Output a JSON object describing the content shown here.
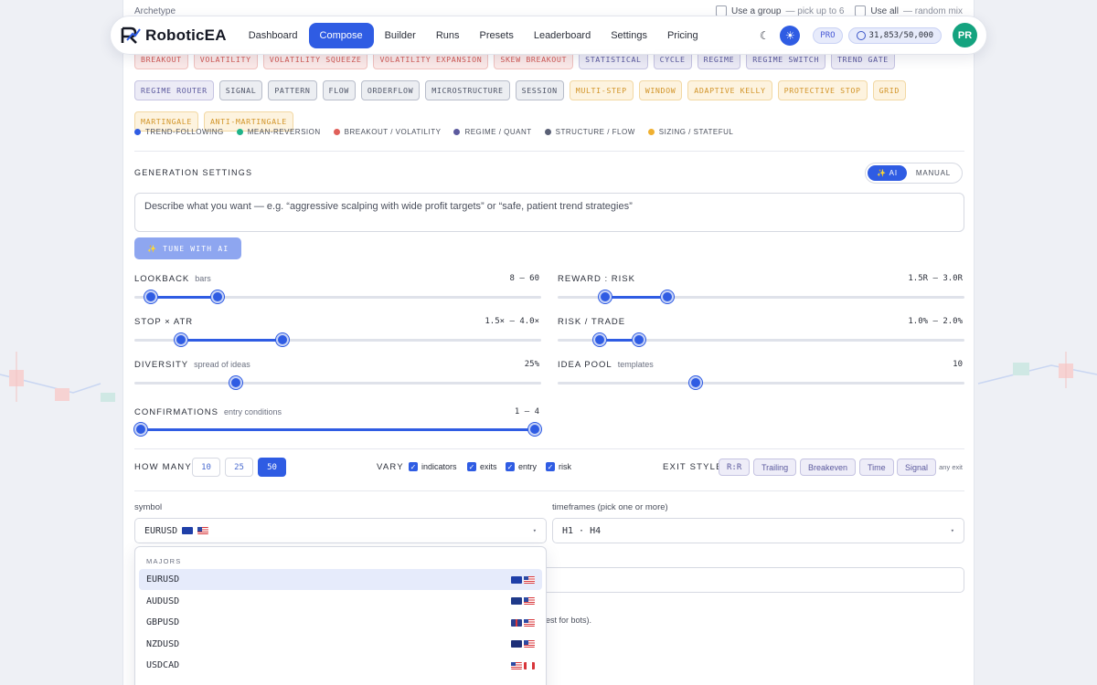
{
  "archetype_label": "Archetype",
  "group_options": {
    "use_group": "Use a group",
    "use_group_hint": "— pick up to 6",
    "use_all": "Use all",
    "use_all_hint": "— random mix"
  },
  "nav": {
    "brand": "RoboticEA",
    "links": [
      "Dashboard",
      "Compose",
      "Builder",
      "Runs",
      "Presets",
      "Leaderboard",
      "Settings",
      "Pricing"
    ],
    "active": "Compose",
    "plan_badge": "PRO",
    "credits": "31,853/50,000",
    "avatar_initials": "PR"
  },
  "chips": {
    "row1": [
      {
        "label": "BREAKOUT",
        "tone": "red"
      },
      {
        "label": "VOLATILITY",
        "tone": "red"
      },
      {
        "label": "VOLATILITY SQUEEZE",
        "tone": "red"
      },
      {
        "label": "VOLATILITY EXPANSION",
        "tone": "red"
      },
      {
        "label": "SKEW BREAKOUT",
        "tone": "red"
      },
      {
        "label": "STATISTICAL",
        "tone": "purple"
      },
      {
        "label": "CYCLE",
        "tone": "purple"
      },
      {
        "label": "REGIME",
        "tone": "purple"
      },
      {
        "label": "REGIME SWITCH",
        "tone": "purple"
      },
      {
        "label": "TREND GATE",
        "tone": "purple"
      }
    ],
    "row2": [
      {
        "label": "REGIME ROUTER",
        "tone": "purple"
      },
      {
        "label": "SIGNAL",
        "tone": "gray"
      },
      {
        "label": "PATTERN",
        "tone": "gray"
      },
      {
        "label": "FLOW",
        "tone": "gray"
      },
      {
        "label": "ORDERFLOW",
        "tone": "gray"
      },
      {
        "label": "MICROSTRUCTURE",
        "tone": "gray"
      },
      {
        "label": "SESSION",
        "tone": "gray"
      },
      {
        "label": "MULTI-STEP",
        "tone": "yellow"
      },
      {
        "label": "WINDOW",
        "tone": "yellow"
      },
      {
        "label": "ADAPTIVE KELLY",
        "tone": "yellow"
      },
      {
        "label": "PROTECTIVE STOP",
        "tone": "yellow"
      },
      {
        "label": "GRID",
        "tone": "yellow"
      }
    ],
    "row3": [
      {
        "label": "MARTINGALE",
        "tone": "yellow"
      },
      {
        "label": "ANTI-MARTINGALE",
        "tone": "yellow"
      }
    ]
  },
  "legend": [
    {
      "label": "TREND-FOLLOWING",
      "color": "#2f5ce3"
    },
    {
      "label": "MEAN-REVERSION",
      "color": "#1fb38a"
    },
    {
      "label": "BREAKOUT / VOLATILITY",
      "color": "#e0605a"
    },
    {
      "label": "REGIME / QUANT",
      "color": "#5c5a9e"
    },
    {
      "label": "STRUCTURE / FLOW",
      "color": "#5a6075"
    },
    {
      "label": "SIZING / STATEFUL",
      "color": "#f0b030"
    }
  ],
  "generation": {
    "title": "GENERATION SETTINGS",
    "mode_ai": "✨ AI",
    "mode_manual": "MANUAL",
    "prompt_placeholder": "Describe what you want — e.g. “aggressive scalping with wide profit targets” or “safe, patient trend strategies”",
    "tune_button": "TUNE WITH AI",
    "tune_icon": "sparkle-icon"
  },
  "sliders": {
    "lookback": {
      "label": "LOOKBACK",
      "sub": "bars",
      "value_text": "8 – 60",
      "low": 0.04,
      "high": 0.205
    },
    "reward_risk": {
      "label": "REWARD : RISK",
      "sub": "",
      "value_text": "1.5R – 3.0R",
      "low": 0.117,
      "high": 0.27
    },
    "stop_atr": {
      "label": "STOP × ATR",
      "sub": "",
      "value_text": "1.5× – 4.0×",
      "low": 0.115,
      "high": 0.365
    },
    "risk_trade": {
      "label": "RISK / TRADE",
      "sub": "",
      "value_text": "1.0% – 2.0%",
      "low": 0.103,
      "high": 0.2
    },
    "diversity": {
      "label": "DIVERSITY",
      "sub": "spread of ideas",
      "value_text": "25%",
      "value": 0.25
    },
    "idea_pool": {
      "label": "IDEA POOL",
      "sub": "templates",
      "value_text": "10",
      "value": 0.34
    },
    "confirmations": {
      "label": "CONFIRMATIONS",
      "sub": "entry conditions",
      "value_text": "1 – 4",
      "low": 0.0,
      "high": 1.0
    }
  },
  "how_many": {
    "label": "HOW MANY",
    "options": [
      "10",
      "25",
      "50"
    ],
    "selected": "50"
  },
  "vary": {
    "label": "VARY",
    "items": [
      "indicators",
      "exits",
      "entry",
      "risk"
    ]
  },
  "exit_style": {
    "label": "EXIT STYLE",
    "options": [
      "R:R",
      "Trailing",
      "Breakeven",
      "Time",
      "Signal"
    ],
    "hint": "any exit"
  },
  "symbol": {
    "label": "symbol",
    "value": "EURUSD"
  },
  "timeframes": {
    "label": "timeframes (pick one or more)",
    "value": "H1 · H4"
  },
  "ghost_hint": "est for bots).",
  "dropdown": {
    "group": "MAJORS",
    "items": [
      {
        "label": "EURUSD",
        "flags": [
          "eu",
          "us"
        ],
        "selected": true
      },
      {
        "label": "AUDUSD",
        "flags": [
          "au",
          "us"
        ],
        "selected": false
      },
      {
        "label": "GBPUSD",
        "flags": [
          "gb",
          "us"
        ],
        "selected": false
      },
      {
        "label": "NZDUSD",
        "flags": [
          "nz",
          "us"
        ],
        "selected": false
      },
      {
        "label": "USDCAD",
        "flags": [
          "us",
          "ca"
        ],
        "selected": false
      }
    ]
  }
}
